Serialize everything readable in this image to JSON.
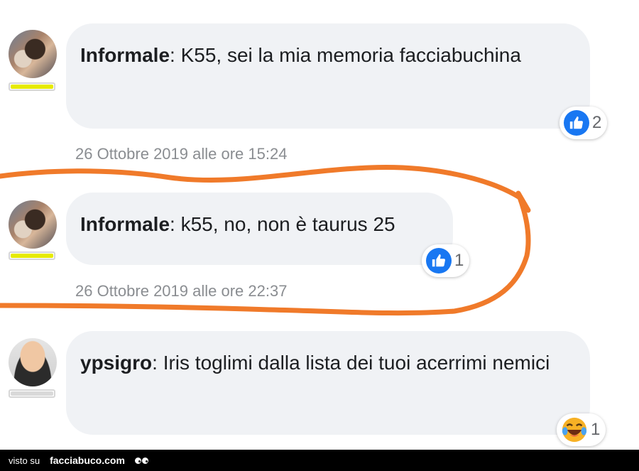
{
  "comments": [
    {
      "author": "Informale",
      "separator": ": ",
      "text": "K55, sei la mia memoria facciabuchina",
      "reaction": "like",
      "reaction_count": "2",
      "timestamp": "26 Ottobre 2019 alle ore 15:24",
      "badge_color": "#e6ea00"
    },
    {
      "author": "Informale",
      "separator": ": ",
      "text": "k55, no, non è taurus 25",
      "reaction": "like",
      "reaction_count": "1",
      "timestamp": "26 Ottobre 2019 alle ore 22:37",
      "badge_color": "#e6ea00"
    },
    {
      "author": "ypsigro",
      "separator": ": ",
      "text": "Iris toglimi dalla lista dei tuoi acerrimi nemici",
      "reaction": "haha",
      "reaction_count": "1",
      "badge_color": "#d9d9d9"
    }
  ],
  "annotation_color": "#f07a2a",
  "watermark": {
    "prefix": "visto su",
    "site": "facciabuco.com"
  }
}
